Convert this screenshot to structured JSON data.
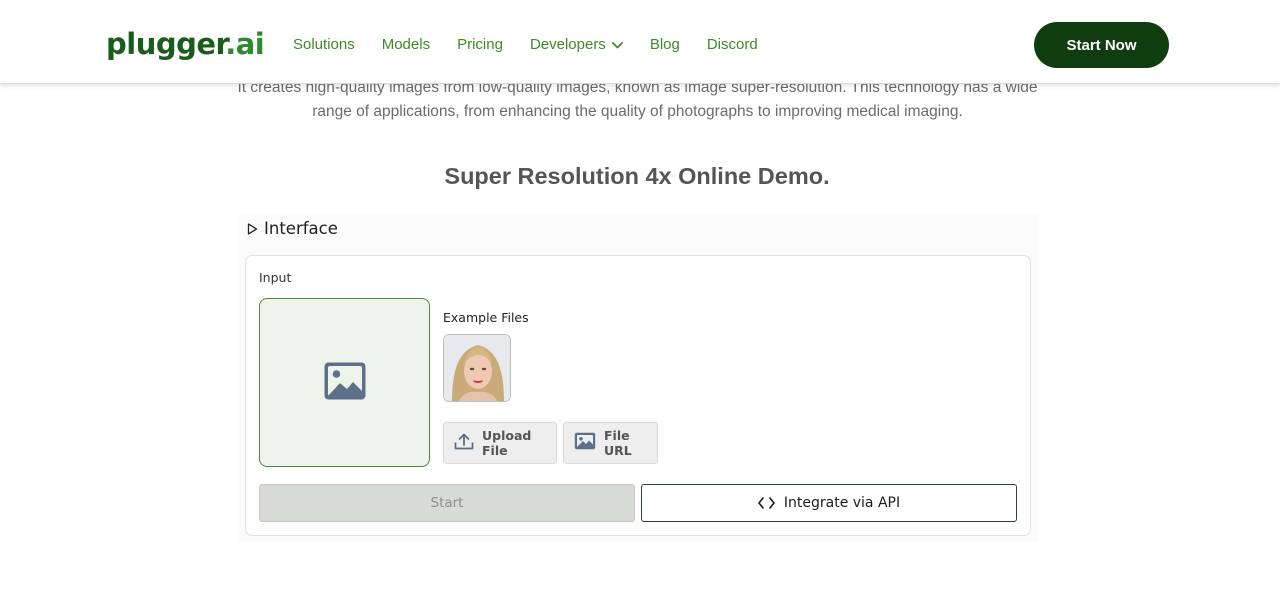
{
  "brand": {
    "logo_main": "plugger",
    "logo_suffix": ".ai"
  },
  "nav": {
    "items": [
      {
        "label": "Solutions"
      },
      {
        "label": "Models"
      },
      {
        "label": "Pricing"
      },
      {
        "label": "Developers",
        "dropdown": true
      },
      {
        "label": "Blog"
      },
      {
        "label": "Discord"
      }
    ],
    "cta_label": "Start Now"
  },
  "intro": {
    "line1": "It creates high-quality images from low-quality images, known as image super-resolution. This technology has a wide",
    "line2": "range of applications, from enhancing the quality of photographs to improving medical imaging."
  },
  "demo": {
    "title": "Super Resolution 4x Online Demo.",
    "interface_label": "Interface",
    "input_label": "Input",
    "example_files_label": "Example Files",
    "upload_label": "Upload File",
    "url_label": "File URL",
    "start_label": "Start",
    "api_label": "Integrate via API"
  },
  "colors": {
    "brand_dark": "#0f3d0f",
    "nav_green": "#3e8a28",
    "dropzone_bg": "#eef3ec",
    "dropzone_border": "#4a8a3a",
    "start_disabled_bg": "#d6dcd5"
  },
  "icons": {
    "dropzone": "image-placeholder-icon",
    "upload": "upload-icon",
    "url": "image-icon",
    "api": "code-icon",
    "interface_toggle": "triangle-right-icon",
    "developers_dropdown": "chevron-down-icon"
  }
}
